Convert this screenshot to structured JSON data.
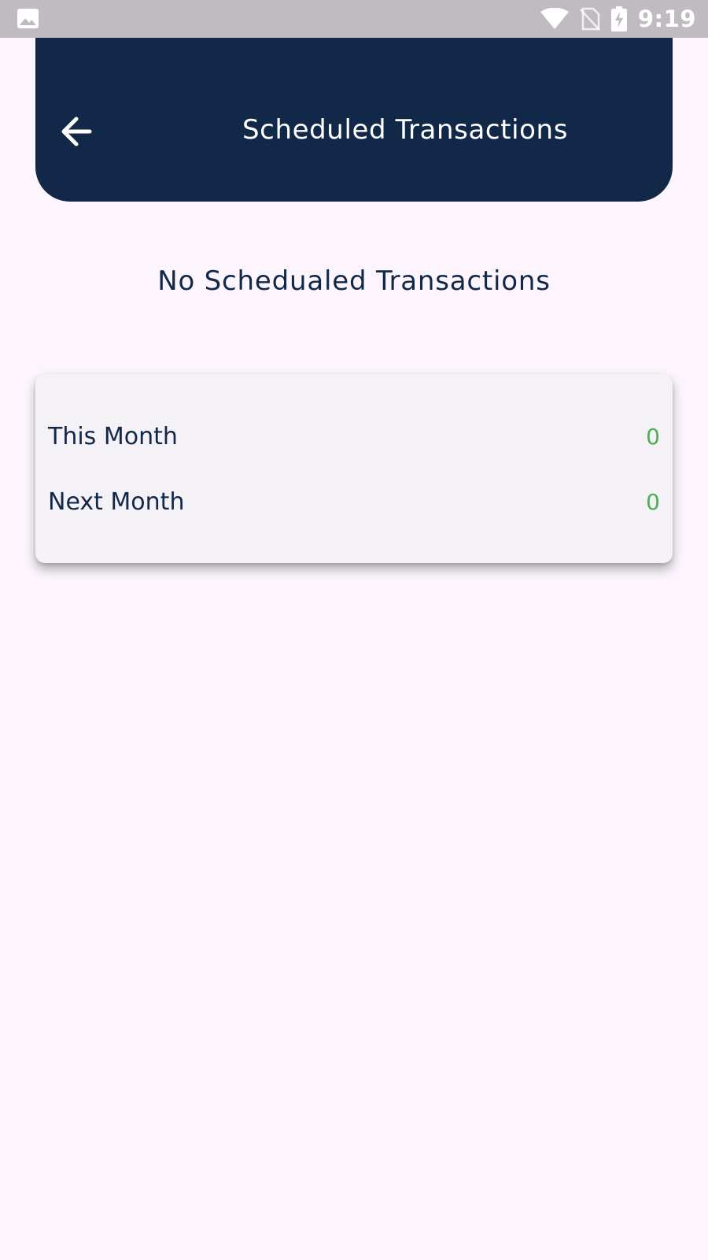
{
  "status_bar": {
    "time": "9:19",
    "icons": [
      "gallery-icon",
      "wifi-icon",
      "no-sim-icon",
      "battery-charging-icon"
    ]
  },
  "header": {
    "title": "Scheduled Transactions",
    "back_icon": "arrow-left-icon"
  },
  "empty_state": {
    "message": "No Schedualed Transactions"
  },
  "summary": {
    "rows": [
      {
        "label": "This Month",
        "value": "0"
      },
      {
        "label": "Next Month",
        "value": "0"
      }
    ]
  },
  "colors": {
    "background": "#fcf5fd",
    "header": "#112849",
    "card": "#f4f1f7",
    "text": "#112849",
    "value_positive": "#4caf50",
    "status_bar": "#c0bbc1"
  }
}
